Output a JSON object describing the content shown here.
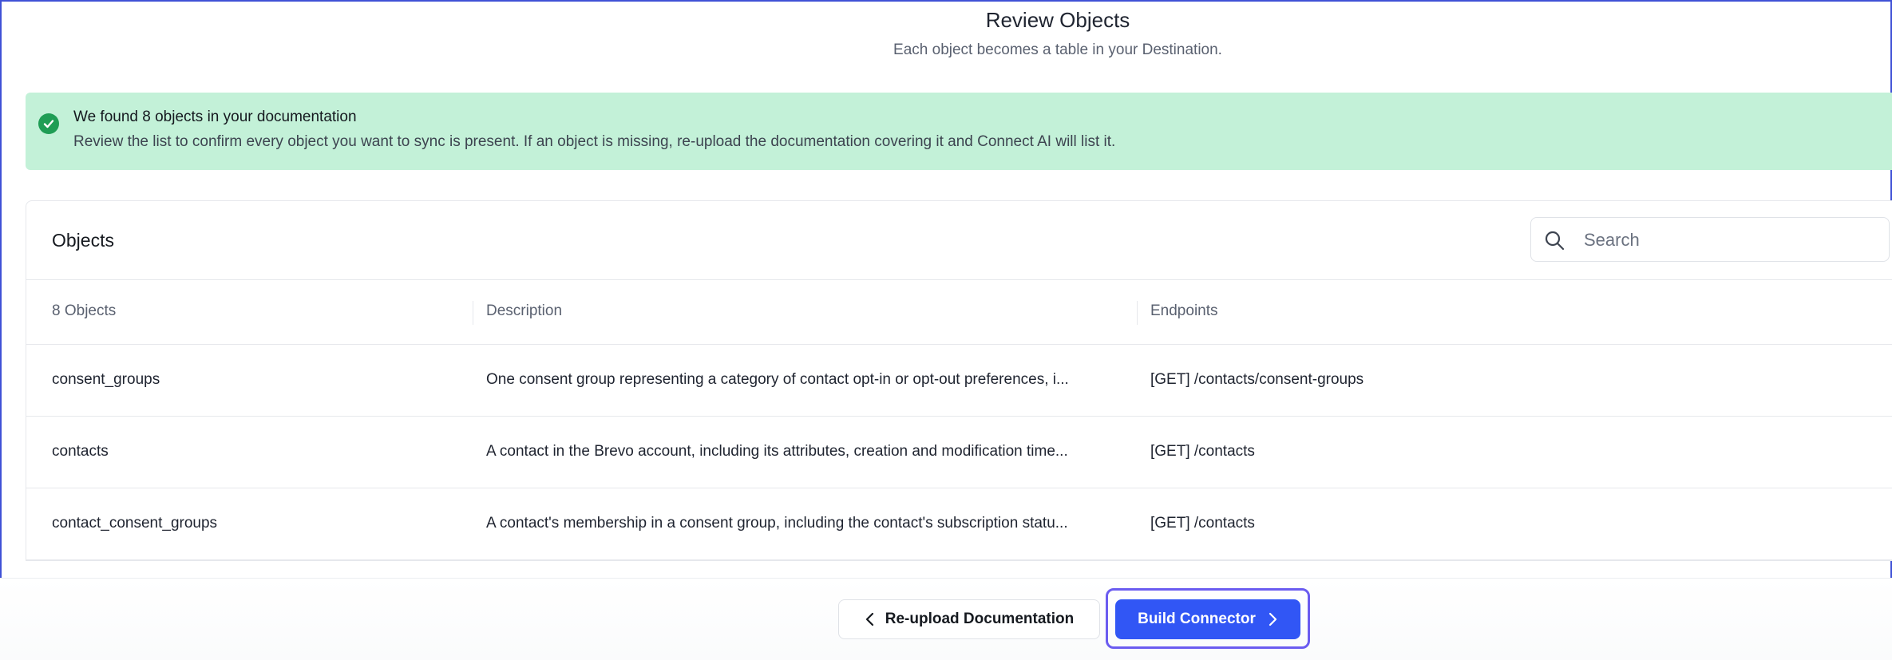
{
  "header": {
    "title": "Review Objects",
    "subtitle": "Each object becomes a table in your Destination."
  },
  "banner": {
    "icon": "check-circle-icon",
    "title": "We found 8 objects in your documentation",
    "text": "Review the list to confirm every object you want to sync is present. If an object is missing, re-upload the documentation covering it and Connect AI will list it.",
    "color": "#c3f1d8",
    "icon_color": "#1f9d55"
  },
  "objects_card": {
    "title": "Objects",
    "search": {
      "placeholder": "Search",
      "value": "",
      "icon": "search-icon"
    },
    "columns": [
      "8 Objects",
      "Description",
      "Endpoints"
    ],
    "rows": [
      {
        "name": "consent_groups",
        "description": "One consent group representing a category of contact opt-in or opt-out preferences, i...",
        "endpoint": "[GET] /contacts/consent-groups"
      },
      {
        "name": "contacts",
        "description": "A contact in the Brevo account, including its attributes, creation and modification time...",
        "endpoint": "[GET] /contacts"
      },
      {
        "name": "contact_consent_groups",
        "description": "A contact's membership in a consent group, including the contact's subscription statu...",
        "endpoint": "[GET] /contacts"
      }
    ]
  },
  "footer": {
    "reupload_label": "Re-upload Documentation",
    "build_label": "Build Connector",
    "primary_color": "#3156f5",
    "focus_color": "#6b5cf0"
  }
}
